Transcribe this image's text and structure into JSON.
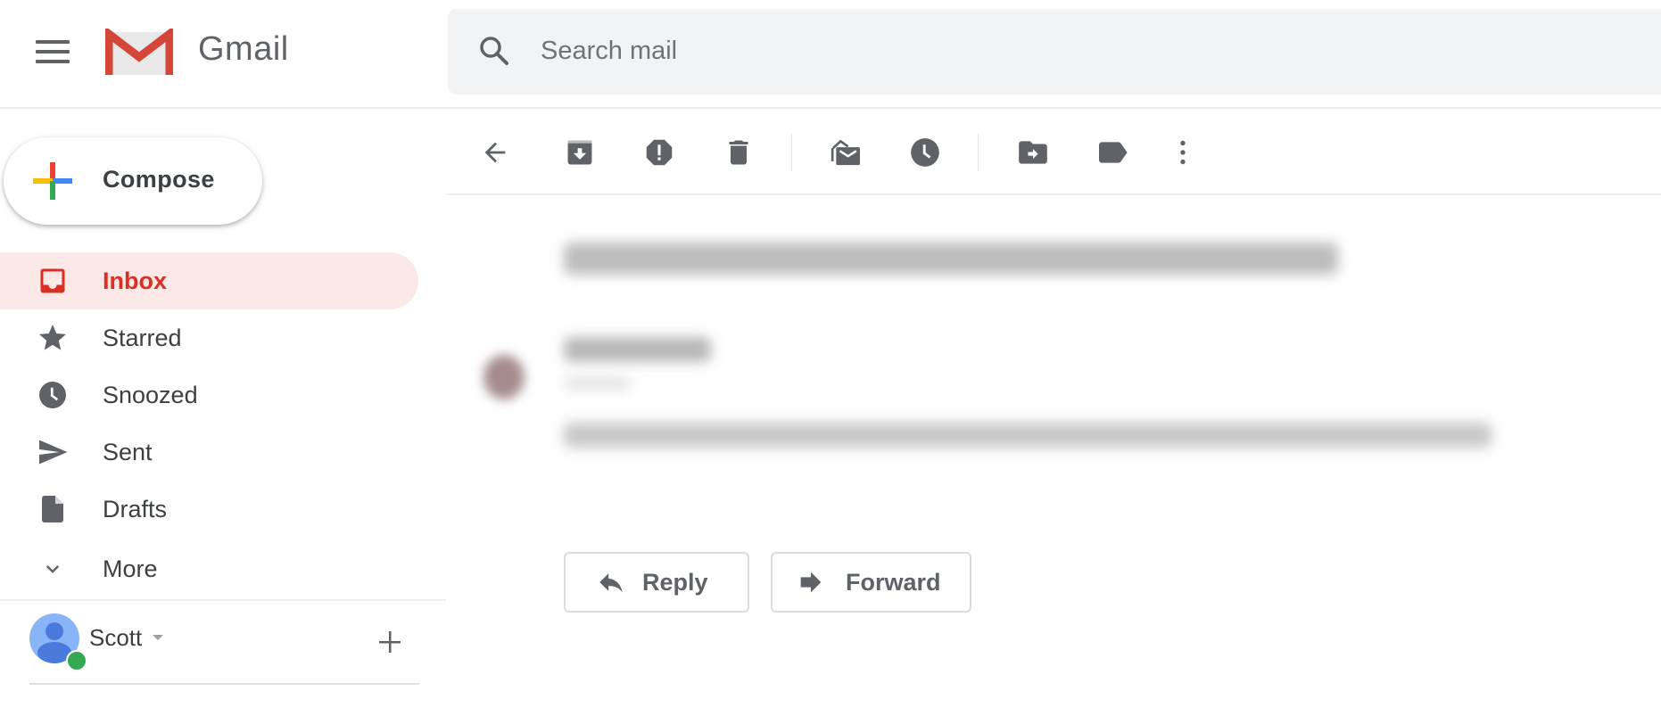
{
  "header": {
    "app_name": "Gmail",
    "search_placeholder": "Search mail",
    "search_value": ""
  },
  "toolbar": {
    "buttons": [
      {
        "name": "back",
        "icon": "arrow-back-icon"
      },
      {
        "name": "archive",
        "icon": "archive-icon"
      },
      {
        "name": "report-spam",
        "icon": "report-spam-icon"
      },
      {
        "name": "delete",
        "icon": "trash-icon"
      },
      {
        "name": "mark-unread",
        "icon": "mark-unread-icon"
      },
      {
        "name": "snooze",
        "icon": "clock-icon"
      },
      {
        "name": "move-to",
        "icon": "move-to-folder-icon"
      },
      {
        "name": "labels",
        "icon": "label-icon"
      },
      {
        "name": "more",
        "icon": "more-vert-icon"
      }
    ]
  },
  "sidebar": {
    "compose_label": "Compose",
    "items": [
      {
        "label": "Inbox",
        "icon": "inbox-icon",
        "active": true
      },
      {
        "label": "Starred",
        "icon": "star-icon",
        "active": false
      },
      {
        "label": "Snoozed",
        "icon": "clock-icon",
        "active": false
      },
      {
        "label": "Sent",
        "icon": "send-icon",
        "active": false
      },
      {
        "label": "Drafts",
        "icon": "draft-icon",
        "active": false
      },
      {
        "label": "More",
        "icon": "chevron-down-icon",
        "active": false
      }
    ],
    "user": {
      "name": "Scott",
      "status": "online"
    }
  },
  "email": {
    "subject": "[blurred]",
    "sender": "[blurred]",
    "body_preview": "[blurred]",
    "actions": {
      "reply_label": "Reply",
      "forward_label": "Forward"
    }
  },
  "colors": {
    "accent_red": "#d93025",
    "active_bg": "#fce8e6",
    "icon_gray": "#5f6368",
    "search_bg": "#f1f3f4",
    "online_green": "#34a853"
  }
}
